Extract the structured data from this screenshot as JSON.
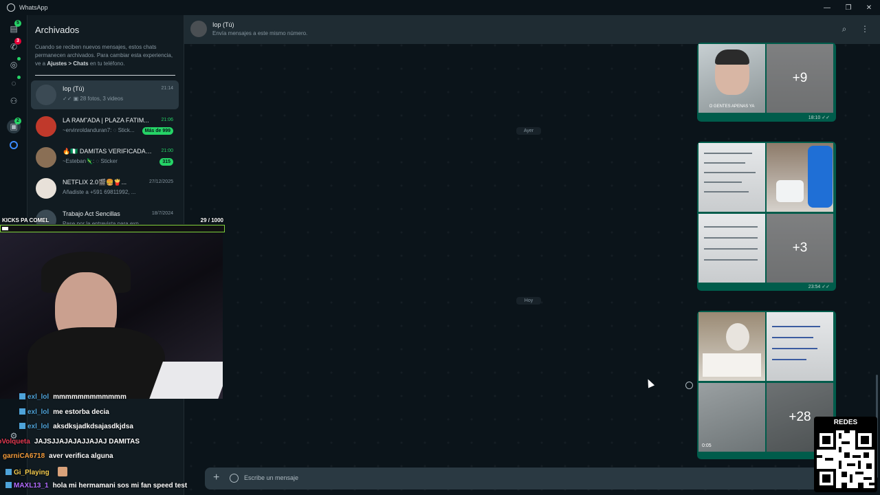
{
  "window": {
    "title": "WhatsApp",
    "minimize": "—",
    "maximize": "❐",
    "close": "✕"
  },
  "rail": {
    "chats_badge": "5",
    "calls_badge": "3",
    "archive_badge": "2"
  },
  "archived": {
    "title": "Archivados",
    "info_prefix": "Cuando se reciben nuevos mensajes, estos chats permanecen archivados. Para cambiar esta experiencia, ve a ",
    "info_bold": "Ajustes > Chats",
    "info_suffix": " en tu teléfono.",
    "chats": [
      {
        "name": "Iop (Tú)",
        "time": "21:14",
        "preview": "✓✓ ▣ 28 fotos, 3 videos",
        "count": "",
        "time_green": false
      },
      {
        "name": "L͟A RAM˜ADA | PLAZA F͟ATIM...",
        "time": "21:06",
        "preview": "~ervinroldanduran7: ◌ Stick...",
        "count": "Más de 999",
        "time_green": true
      },
      {
        "name": "🔥🇳🇬 DAMITAS VERIFICADAS...",
        "time": "21:00",
        "preview": "~Esteban🦎: ◌ Sticker",
        "count": "315",
        "time_green": true
      },
      {
        "name": "NETFLIX 2.0🎬🍔🍟...",
        "time": "27/12/2025",
        "preview": "Añadiste a +591 69811992, ...",
        "count": "",
        "time_green": false
      },
      {
        "name": "Trabajo Act Sencillas",
        "time": "18/7/2024",
        "preview": "Pase por la entrevista para explicar a de...",
        "count": "",
        "time_green": false
      }
    ]
  },
  "conversation": {
    "name": "Iop (Tú)",
    "subtitle": "Envía mensajes a este mismo número.",
    "day_ayer": "Ayer",
    "day_hoy": "Hoy",
    "album1": {
      "more": "+9",
      "time": "18:10 ✓✓",
      "caption": "O GENTES APENAS YA"
    },
    "album2": {
      "more": "+3",
      "time": "23:54 ✓✓"
    },
    "album3": {
      "more": "+28",
      "duration": "0:05"
    },
    "input_placeholder": "Escribe un mensaje"
  },
  "overlay": {
    "kicks_label": "KICKS PA COMEL",
    "kicks_value": "29  / 1000",
    "kicks_progress": 0.029,
    "chat": [
      {
        "user": "exl_lol",
        "color": "#4ea3d9",
        "text": "mmmmmmmmmmmm"
      },
      {
        "user": "exl_lol",
        "color": "#4ea3d9",
        "text": "me estorba decia"
      },
      {
        "user": "exl_lol",
        "color": "#4ea3d9",
        "text": "aksdksjadkdsajasdkjdsa"
      },
      {
        "user": "PrimoVolqueta",
        "color": "#e53950",
        "text": "JAJSJJAJAJAJJAJAJ DAMITAS"
      },
      {
        "user": "garniCA6718",
        "color": "#f29a3a",
        "text": "aver verifica alguna"
      },
      {
        "user": "Gi_Playing",
        "color": "#f2c94c",
        "text": ""
      },
      {
        "user": "MAXL13_1",
        "color": "#b36bff",
        "text": "hola mi hermamani sos mi fan speed test"
      }
    ],
    "redes_label": "REDES"
  }
}
